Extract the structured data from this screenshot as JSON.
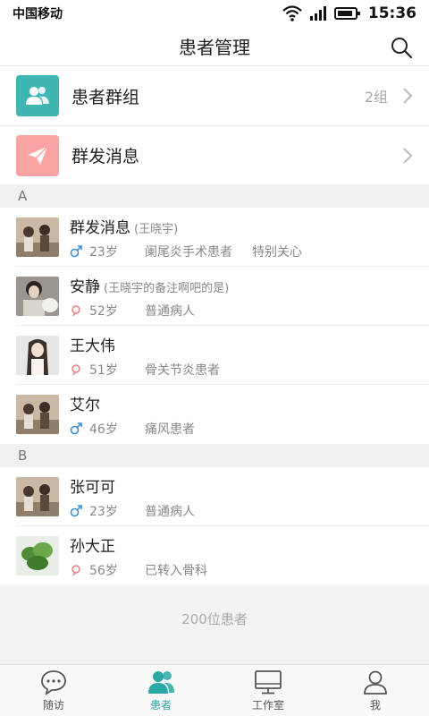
{
  "status": {
    "carrier": "中国移动",
    "time": "15:36"
  },
  "header": {
    "title": "患者管理"
  },
  "menu": [
    {
      "label": "患者群组",
      "count": "2组",
      "icon": "people-icon",
      "color": "#3fb6b2"
    },
    {
      "label": "群发消息",
      "count": "",
      "icon": "send-icon",
      "color": "#f47c7c"
    }
  ],
  "sections": [
    {
      "letter": "A",
      "patients": [
        {
          "name": "群发消息",
          "note": "(王晓宇)",
          "gender": "male",
          "age": "23岁",
          "tags": [
            "阑尾炎手术患者",
            "特别关心"
          ]
        },
        {
          "name": "安静",
          "note": "(王晓宇的备注啊吧的是)",
          "gender": "female",
          "age": "52岁",
          "tags": [
            "普通病人"
          ]
        },
        {
          "name": "王大伟",
          "note": "",
          "gender": "female",
          "age": "51岁",
          "tags": [
            "骨关节炎患者"
          ]
        },
        {
          "name": "艾尔",
          "note": "",
          "gender": "male",
          "age": "46岁",
          "tags": [
            "痛风患者"
          ]
        }
      ]
    },
    {
      "letter": "B",
      "patients": [
        {
          "name": "张可可",
          "note": "",
          "gender": "male",
          "age": "23岁",
          "tags": [
            "普通病人"
          ]
        },
        {
          "name": "孙大正",
          "note": "",
          "gender": "female",
          "age": "56岁",
          "tags": [
            "已转入骨科"
          ]
        }
      ]
    }
  ],
  "footer": {
    "total": "200位患者"
  },
  "tabs": [
    {
      "label": "随访",
      "icon": "chat-bubble-icon",
      "active": false
    },
    {
      "label": "患者",
      "icon": "patients-icon",
      "active": true
    },
    {
      "label": "工作室",
      "icon": "monitor-icon",
      "active": false
    },
    {
      "label": "我",
      "icon": "user-icon",
      "active": false
    }
  ],
  "colors": {
    "accent": "#2aa9a6",
    "male": "#3a8fd6",
    "female": "#f07f7f"
  }
}
